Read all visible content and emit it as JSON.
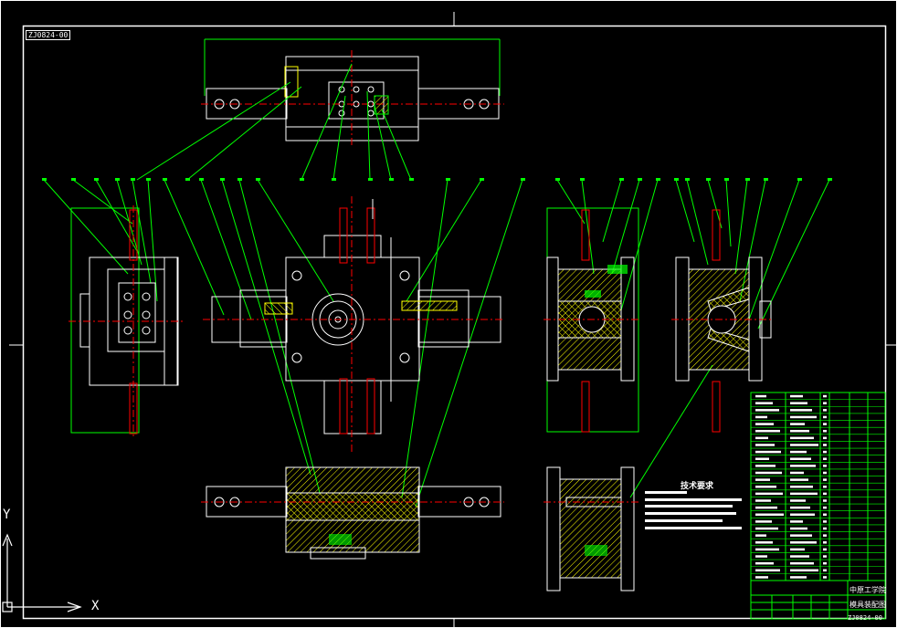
{
  "drawing": {
    "drawing_number": "ZJ0824-00",
    "tech_requirements_title": "技术要求",
    "title_block_school": "中原工学院",
    "title_block_part": "模具装配图",
    "title_block_number": "ZJ0824-00"
  },
  "ucs": {
    "x_label": "X",
    "y_label": "Y"
  },
  "colors": {
    "background": "#000000",
    "outline": "#ffffff",
    "leader": "#00ff00",
    "center": "#ff0000",
    "hidden": "#ff0000",
    "hatch": "#ffff00",
    "accent_cyan": "#00ffff",
    "accent_magenta": "#ff00ff"
  }
}
